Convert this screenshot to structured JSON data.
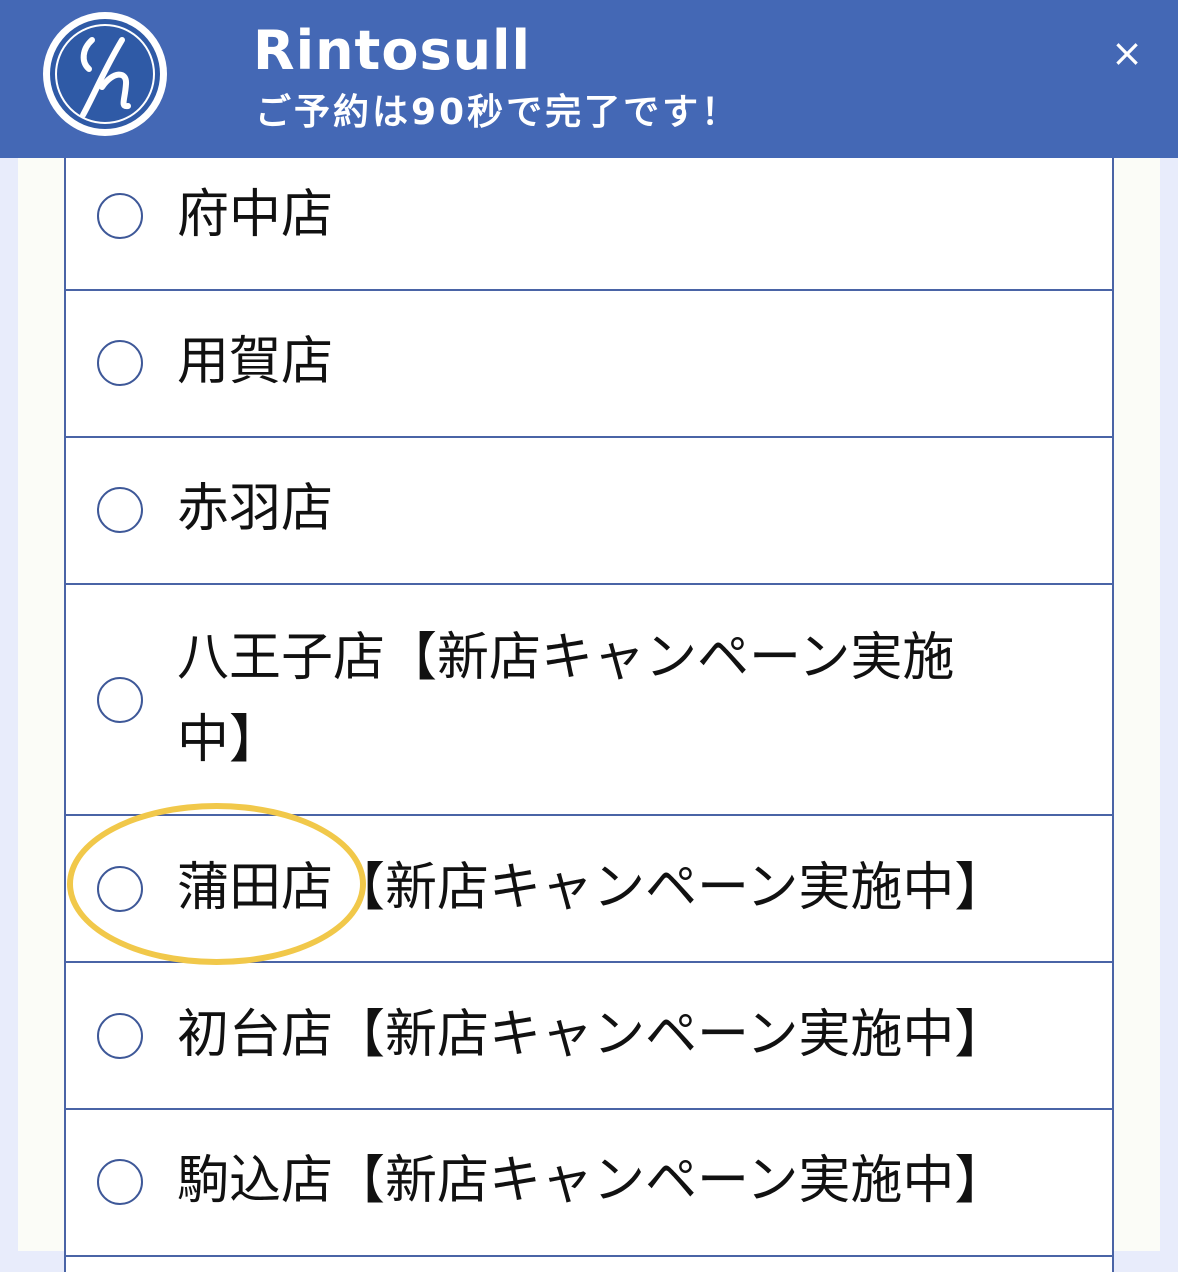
{
  "header": {
    "title": "Rintosull",
    "subtitle": "ご予約は90秒で完了です！",
    "close_label": "×",
    "logo_icon": "rintosull-logo-icon"
  },
  "stores": [
    {
      "label": "府中店"
    },
    {
      "label": "用賀店"
    },
    {
      "label": "赤羽店"
    },
    {
      "label": "八王子店【新店キャンペーン実施中】"
    },
    {
      "label": "蒲田店【新店キャンペーン実施中】",
      "highlighted": true
    },
    {
      "label": "初台店【新店キャンペーン実施中】"
    },
    {
      "label": "駒込店【新店キャンペーン実施中】"
    }
  ],
  "colors": {
    "header": "#4468b5",
    "border": "#4a64a6",
    "radio": "#3e5898",
    "highlight": "#f1c84a",
    "background": "#e8ecfb"
  }
}
